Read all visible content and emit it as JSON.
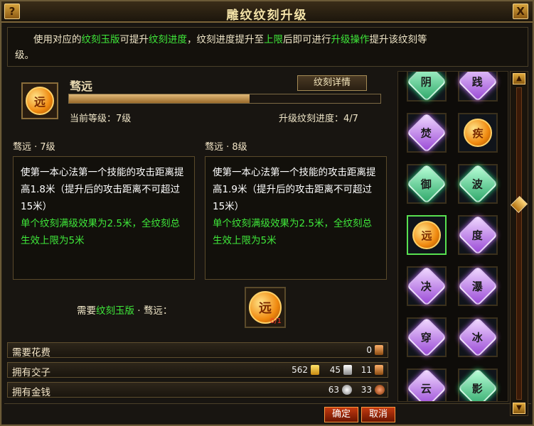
{
  "window": {
    "title": "雕纹纹刻升级",
    "help_label": "?",
    "close_label": "X"
  },
  "info": {
    "p1": "使用对应的",
    "p2": "纹刻玉版",
    "p3": "可提升",
    "p4": "纹刻进度",
    "p5": "，纹刻进度提升至",
    "p6": "上限",
    "p7": "后即可进行",
    "p8": "升级操作",
    "p9": "提升该纹刻等",
    "p10": "级。"
  },
  "item": {
    "name": "骛远",
    "icon_char": "远",
    "detail_button": "纹刻详情",
    "progress_fraction": 0.58,
    "current_level": "当前等级：7级",
    "upgrade_progress": "升级纹刻进度：4/7"
  },
  "current": {
    "heading": "骛远 · 7级",
    "desc_white": "使第一本心法第一个技能的攻击距离提高1.8米（提升后的攻击距离不可超过15米）",
    "desc_green": "单个纹刻满级效果为2.5米，全纹刻总生效上限为5米"
  },
  "next": {
    "heading": "骛远 · 8级",
    "desc_white": "使第一本心法第一个技能的攻击距离提高1.9米（提升后的攻击距离不可超过15米）",
    "desc_green": "单个纹刻满级效果为2.5米，全纹刻总生效上限为5米"
  },
  "need": {
    "pre": "需要",
    "item_green": "纹刻玉版",
    "post": " · 骛远：",
    "count": "0/1"
  },
  "resources": {
    "cost_label": "需要花费",
    "cost_value": "0",
    "jiaozi_label": "拥有交子",
    "jiaozi_gold": "562",
    "jiaozi_silver": "45",
    "jiaozi_copper": "11",
    "money_label": "拥有金钱",
    "money_silver": "63",
    "money_copper": "33"
  },
  "buttons": {
    "confirm": "确定",
    "cancel": "取消"
  },
  "grid": [
    {
      "char": "阴",
      "style": "green"
    },
    {
      "char": "践",
      "style": "purple"
    },
    {
      "char": "焚",
      "style": "purple"
    },
    {
      "char": "疾",
      "style": "orange"
    },
    {
      "char": "御",
      "style": "green"
    },
    {
      "char": "波",
      "style": "green"
    },
    {
      "char": "远",
      "style": "orange"
    },
    {
      "char": "度",
      "style": "purple"
    },
    {
      "char": "决",
      "style": "purple"
    },
    {
      "char": "瀑",
      "style": "purple"
    },
    {
      "char": "穿",
      "style": "purple"
    },
    {
      "char": "冰",
      "style": "purple"
    },
    {
      "char": "云",
      "style": "purple"
    },
    {
      "char": "影",
      "style": "green"
    }
  ]
}
